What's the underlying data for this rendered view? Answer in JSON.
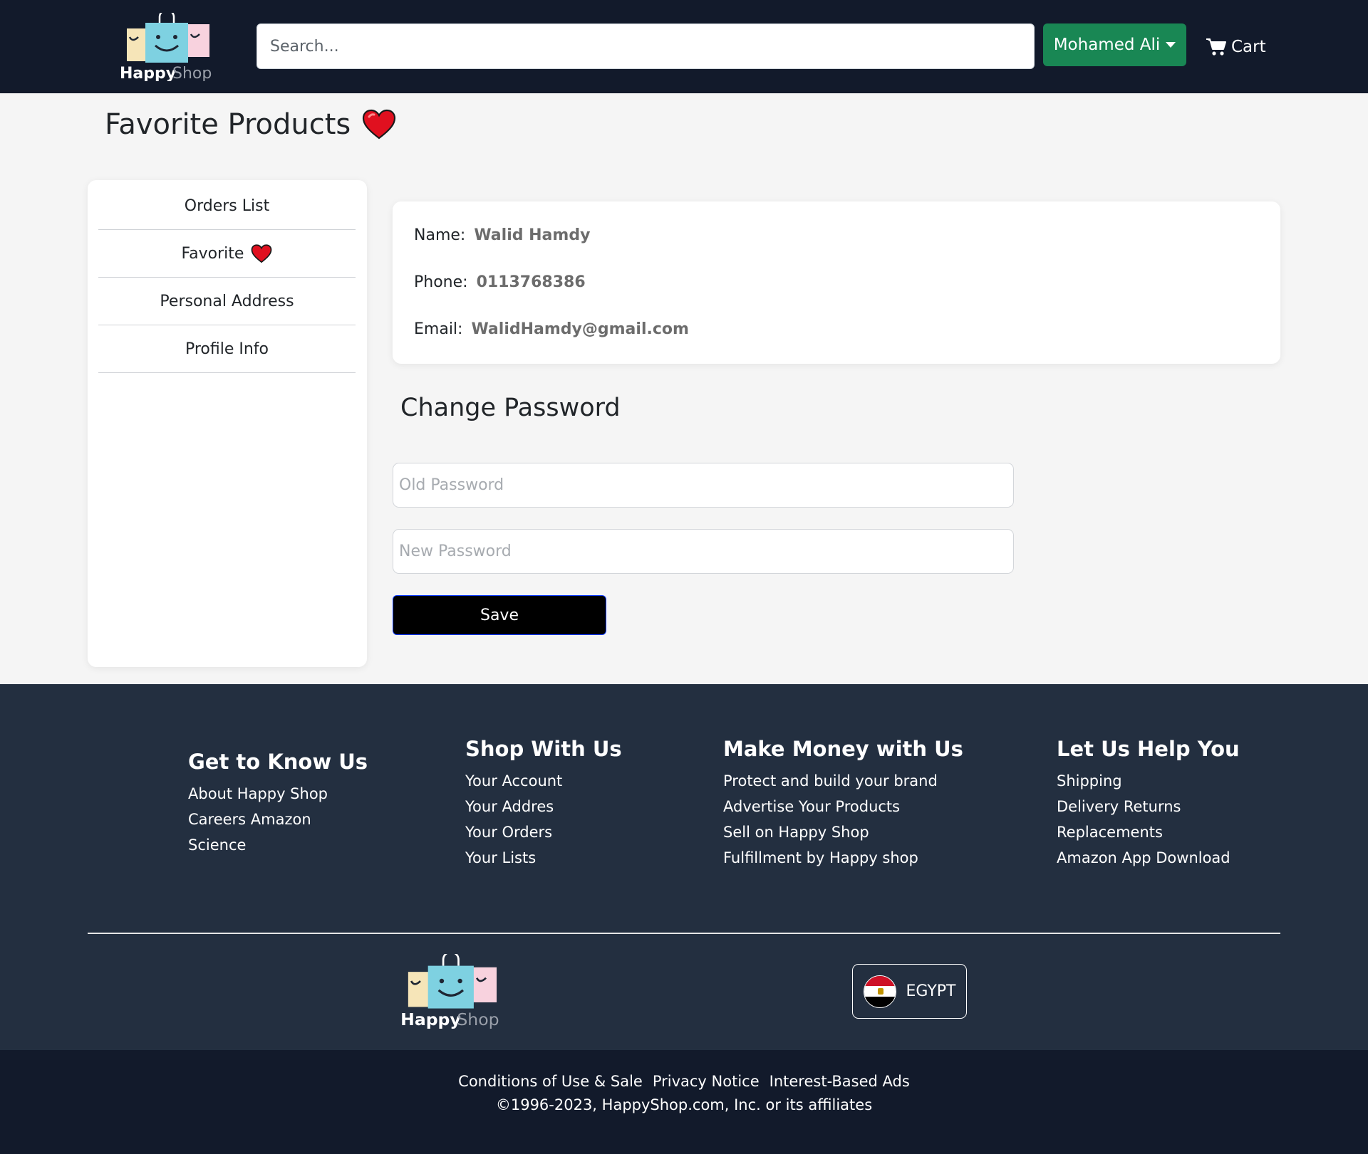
{
  "header": {
    "logo": {
      "word1": "Happy",
      "word2": "Shop"
    },
    "search_placeholder": "Search...",
    "user_name": "Mohamed Ali",
    "cart_label": "Cart"
  },
  "page": {
    "title": "Favorite Products",
    "title_icon": "heart-icon"
  },
  "sidebar": {
    "items": [
      {
        "label": "Orders List"
      },
      {
        "label": "Favorite",
        "icon": "heart-icon"
      },
      {
        "label": "Personal Address"
      },
      {
        "label": "Profile Info"
      }
    ]
  },
  "profile": {
    "name_label": "Name:",
    "name_value": "Walid Hamdy",
    "phone_label": "Phone:",
    "phone_value": "0113768386",
    "email_label": "Email:",
    "email_value": "WalidHamdy@gmail.com"
  },
  "change_password": {
    "title": "Change Password",
    "old_placeholder": "Old Password",
    "new_placeholder": "New Password",
    "save_label": "Save"
  },
  "footer": {
    "columns": [
      {
        "title": "Get to Know Us",
        "links": [
          "About Happy Shop",
          "Careers Amazon",
          "Science"
        ]
      },
      {
        "title": "Shop With Us",
        "links": [
          "Your Account",
          "Your Addres",
          "Your Orders",
          "Your Lists"
        ]
      },
      {
        "title": "Make Money with Us",
        "links": [
          "Protect and build your brand",
          "Advertise Your Products",
          "Sell on Happy Shop",
          "Fulfillment by Happy shop"
        ]
      },
      {
        "title": "Let Us Help You",
        "links": [
          "Shipping",
          "Delivery Returns",
          "Replacements",
          "Amazon App Download"
        ]
      }
    ],
    "logo": {
      "word1": "Happy",
      "word2": "Shop"
    },
    "country": "EGYPT",
    "legal_links": [
      "Conditions of Use & Sale",
      "Privacy Notice",
      "Interest-Based Ads"
    ],
    "copyright": "©1996-2023, HappyShop.com, Inc. or its affiliates"
  },
  "colors": {
    "header_bg": "#121a2b",
    "footer_bg": "#232f40",
    "user_button": "#198754",
    "heart": "#e0101f",
    "logo_blue": "#7ed1e1",
    "logo_yellow": "#f6e5b8",
    "logo_pink": "#f8d2de"
  }
}
